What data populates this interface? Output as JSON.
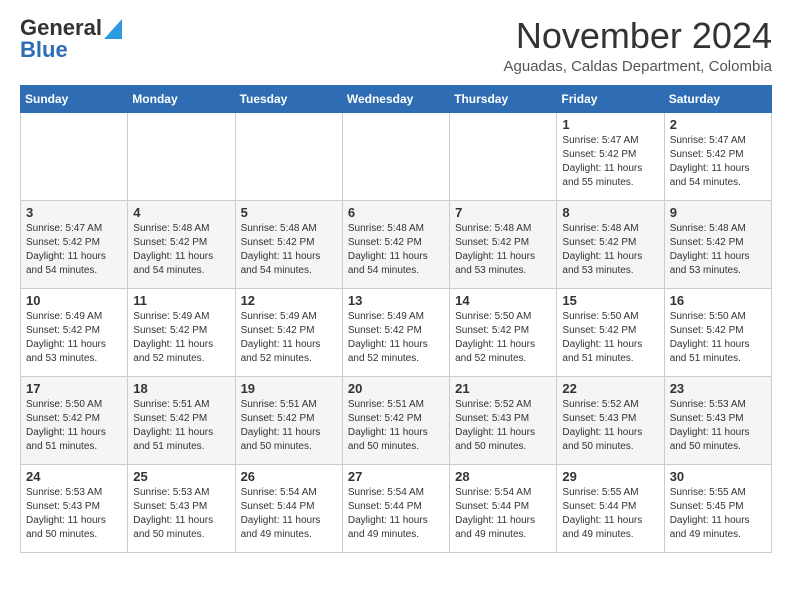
{
  "header": {
    "logo_general": "General",
    "logo_blue": "Blue",
    "month_title": "November 2024",
    "location": "Aguadas, Caldas Department, Colombia"
  },
  "weekdays": [
    "Sunday",
    "Monday",
    "Tuesday",
    "Wednesday",
    "Thursday",
    "Friday",
    "Saturday"
  ],
  "weeks": [
    [
      {
        "day": "",
        "info": ""
      },
      {
        "day": "",
        "info": ""
      },
      {
        "day": "",
        "info": ""
      },
      {
        "day": "",
        "info": ""
      },
      {
        "day": "",
        "info": ""
      },
      {
        "day": "1",
        "info": "Sunrise: 5:47 AM\nSunset: 5:42 PM\nDaylight: 11 hours\nand 55 minutes."
      },
      {
        "day": "2",
        "info": "Sunrise: 5:47 AM\nSunset: 5:42 PM\nDaylight: 11 hours\nand 54 minutes."
      }
    ],
    [
      {
        "day": "3",
        "info": "Sunrise: 5:47 AM\nSunset: 5:42 PM\nDaylight: 11 hours\nand 54 minutes."
      },
      {
        "day": "4",
        "info": "Sunrise: 5:48 AM\nSunset: 5:42 PM\nDaylight: 11 hours\nand 54 minutes."
      },
      {
        "day": "5",
        "info": "Sunrise: 5:48 AM\nSunset: 5:42 PM\nDaylight: 11 hours\nand 54 minutes."
      },
      {
        "day": "6",
        "info": "Sunrise: 5:48 AM\nSunset: 5:42 PM\nDaylight: 11 hours\nand 54 minutes."
      },
      {
        "day": "7",
        "info": "Sunrise: 5:48 AM\nSunset: 5:42 PM\nDaylight: 11 hours\nand 53 minutes."
      },
      {
        "day": "8",
        "info": "Sunrise: 5:48 AM\nSunset: 5:42 PM\nDaylight: 11 hours\nand 53 minutes."
      },
      {
        "day": "9",
        "info": "Sunrise: 5:48 AM\nSunset: 5:42 PM\nDaylight: 11 hours\nand 53 minutes."
      }
    ],
    [
      {
        "day": "10",
        "info": "Sunrise: 5:49 AM\nSunset: 5:42 PM\nDaylight: 11 hours\nand 53 minutes."
      },
      {
        "day": "11",
        "info": "Sunrise: 5:49 AM\nSunset: 5:42 PM\nDaylight: 11 hours\nand 52 minutes."
      },
      {
        "day": "12",
        "info": "Sunrise: 5:49 AM\nSunset: 5:42 PM\nDaylight: 11 hours\nand 52 minutes."
      },
      {
        "day": "13",
        "info": "Sunrise: 5:49 AM\nSunset: 5:42 PM\nDaylight: 11 hours\nand 52 minutes."
      },
      {
        "day": "14",
        "info": "Sunrise: 5:50 AM\nSunset: 5:42 PM\nDaylight: 11 hours\nand 52 minutes."
      },
      {
        "day": "15",
        "info": "Sunrise: 5:50 AM\nSunset: 5:42 PM\nDaylight: 11 hours\nand 51 minutes."
      },
      {
        "day": "16",
        "info": "Sunrise: 5:50 AM\nSunset: 5:42 PM\nDaylight: 11 hours\nand 51 minutes."
      }
    ],
    [
      {
        "day": "17",
        "info": "Sunrise: 5:50 AM\nSunset: 5:42 PM\nDaylight: 11 hours\nand 51 minutes."
      },
      {
        "day": "18",
        "info": "Sunrise: 5:51 AM\nSunset: 5:42 PM\nDaylight: 11 hours\nand 51 minutes."
      },
      {
        "day": "19",
        "info": "Sunrise: 5:51 AM\nSunset: 5:42 PM\nDaylight: 11 hours\nand 50 minutes."
      },
      {
        "day": "20",
        "info": "Sunrise: 5:51 AM\nSunset: 5:42 PM\nDaylight: 11 hours\nand 50 minutes."
      },
      {
        "day": "21",
        "info": "Sunrise: 5:52 AM\nSunset: 5:43 PM\nDaylight: 11 hours\nand 50 minutes."
      },
      {
        "day": "22",
        "info": "Sunrise: 5:52 AM\nSunset: 5:43 PM\nDaylight: 11 hours\nand 50 minutes."
      },
      {
        "day": "23",
        "info": "Sunrise: 5:53 AM\nSunset: 5:43 PM\nDaylight: 11 hours\nand 50 minutes."
      }
    ],
    [
      {
        "day": "24",
        "info": "Sunrise: 5:53 AM\nSunset: 5:43 PM\nDaylight: 11 hours\nand 50 minutes."
      },
      {
        "day": "25",
        "info": "Sunrise: 5:53 AM\nSunset: 5:43 PM\nDaylight: 11 hours\nand 50 minutes."
      },
      {
        "day": "26",
        "info": "Sunrise: 5:54 AM\nSunset: 5:44 PM\nDaylight: 11 hours\nand 49 minutes."
      },
      {
        "day": "27",
        "info": "Sunrise: 5:54 AM\nSunset: 5:44 PM\nDaylight: 11 hours\nand 49 minutes."
      },
      {
        "day": "28",
        "info": "Sunrise: 5:54 AM\nSunset: 5:44 PM\nDaylight: 11 hours\nand 49 minutes."
      },
      {
        "day": "29",
        "info": "Sunrise: 5:55 AM\nSunset: 5:44 PM\nDaylight: 11 hours\nand 49 minutes."
      },
      {
        "day": "30",
        "info": "Sunrise: 5:55 AM\nSunset: 5:45 PM\nDaylight: 11 hours\nand 49 minutes."
      }
    ]
  ]
}
